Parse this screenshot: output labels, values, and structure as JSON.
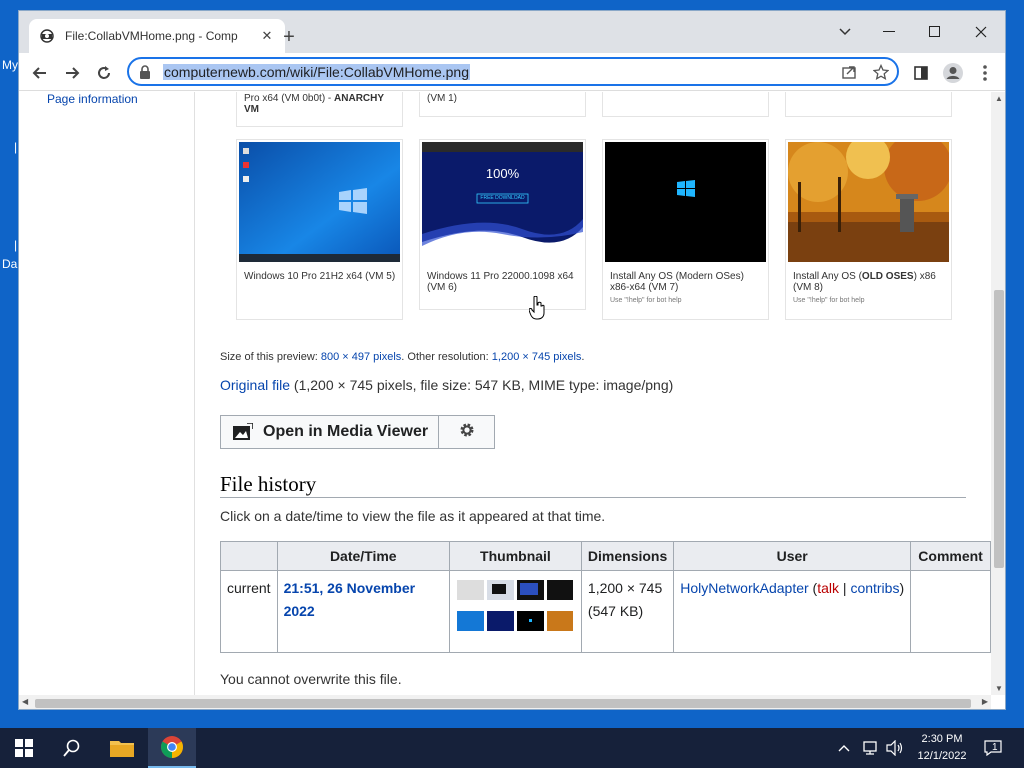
{
  "desktop": {
    "labels": [
      "My",
      "Da"
    ],
    "marks": [
      "|",
      "|"
    ]
  },
  "browser": {
    "tab_title": "File:CollabVMHome.png - Comp",
    "url": "computernewb.com/wiki/File:CollabVMHome.png"
  },
  "sidebar": {
    "page_information": "Page information"
  },
  "gallery": {
    "top_row": [
      {
        "caption": "Pro x64 (VM 0b0t) - ANARCHY VM",
        "caption_plain": "Pro x64 (VM 0b0t) - ",
        "caption_bold": "ANARCHY VM"
      },
      {
        "caption": "(VM 1)"
      },
      {
        "caption": ""
      },
      {
        "caption": ""
      }
    ],
    "items": [
      {
        "caption": "Windows 10 Pro 21H2 x64 (VM 5)",
        "sub": ""
      },
      {
        "caption": "Windows 11 Pro 22000.1098 x64 (VM 6)",
        "sub": "",
        "img_text": "100%",
        "img_button": "FREE DOWNLOAD"
      },
      {
        "caption": "Install Any OS (Modern OSes) x86-x64 (VM 7)",
        "sub": "Use \"!help\" for bot help"
      },
      {
        "caption_plain": "Install Any OS (",
        "caption_bold": "OLD OSES",
        "caption_end": ") x86 (VM 8)",
        "sub": "Use \"!help\" for bot help"
      }
    ]
  },
  "preview": {
    "prefix": "Size of this preview: ",
    "size_link": "800 × 497 pixels",
    "other": ". Other resolution: ",
    "other_link": "1,200 × 745 pixels",
    "suffix": "."
  },
  "original": {
    "link": "Original file",
    "details": " (1,200 × 745 pixels, file size: 547 KB, MIME type: image/png)"
  },
  "media_viewer": {
    "label": "Open in Media Viewer"
  },
  "file_history": {
    "heading": "File history",
    "instruction": "Click on a date/time to view the file as it appeared at that time.",
    "columns": [
      "",
      "Date/Time",
      "Thumbnail",
      "Dimensions",
      "User",
      "Comment"
    ],
    "row": {
      "status": "current",
      "datetime": "21:51, 26 November 2022",
      "dimensions": "1,200 × 745",
      "filesize": "(547 KB)",
      "user": "HolyNetworkAdapter",
      "talk": "talk",
      "contribs": "contribs",
      "comment": ""
    }
  },
  "notice": "You cannot overwrite this file.",
  "taskbar": {
    "time": "2:30 PM",
    "date": "12/1/2022",
    "notifications": "1"
  },
  "colors": {
    "link": "#0645ad",
    "redlink": "#ba0000",
    "omnibox_border": "#1a73e8",
    "taskbar": "#16213a",
    "desktop": "#0f64c8"
  }
}
